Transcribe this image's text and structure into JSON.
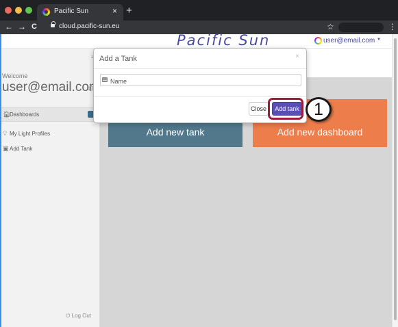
{
  "browser": {
    "tab_title": "Pacific Sun",
    "tab_close": "×",
    "new_tab": "+",
    "back": "←",
    "forward": "→",
    "reload": "C",
    "url": "cloud.pacific-sun.eu",
    "bookmark": "☆",
    "menu": "⋮",
    "traffic_lights": [
      "#ed6a5e",
      "#f5bf4f",
      "#61c554"
    ]
  },
  "header": {
    "brand": "Pacific Sun",
    "user_email": "user@email.com",
    "caret": "▼"
  },
  "sidebar": {
    "toggle": "≡",
    "welcome": "Welcome",
    "email": "user@email.com",
    "cog": "⚙",
    "items": [
      {
        "icon": "🏠︎",
        "label": "Dashboards"
      },
      {
        "icon": "💡︎",
        "label": "My Light Profiles"
      },
      {
        "icon": "▣",
        "label": "Add Tank"
      }
    ],
    "logout": "⏻ Log Out"
  },
  "tiles": {
    "tank": "Add new tank",
    "dashboard": "Add new dashboard"
  },
  "modal": {
    "title": "Add a Tank",
    "close_x": "×",
    "name_placeholder": "Name",
    "close_button": "Close",
    "add_button": "Add tank"
  },
  "annotation": {
    "step_number": "1"
  },
  "colors": {
    "brand": "#4a4aa6",
    "tank_tile": "#52788c",
    "dashboard_tile": "#ee7d4c",
    "add_button": "#5a4fb5",
    "highlight": "#9b1b3a"
  }
}
